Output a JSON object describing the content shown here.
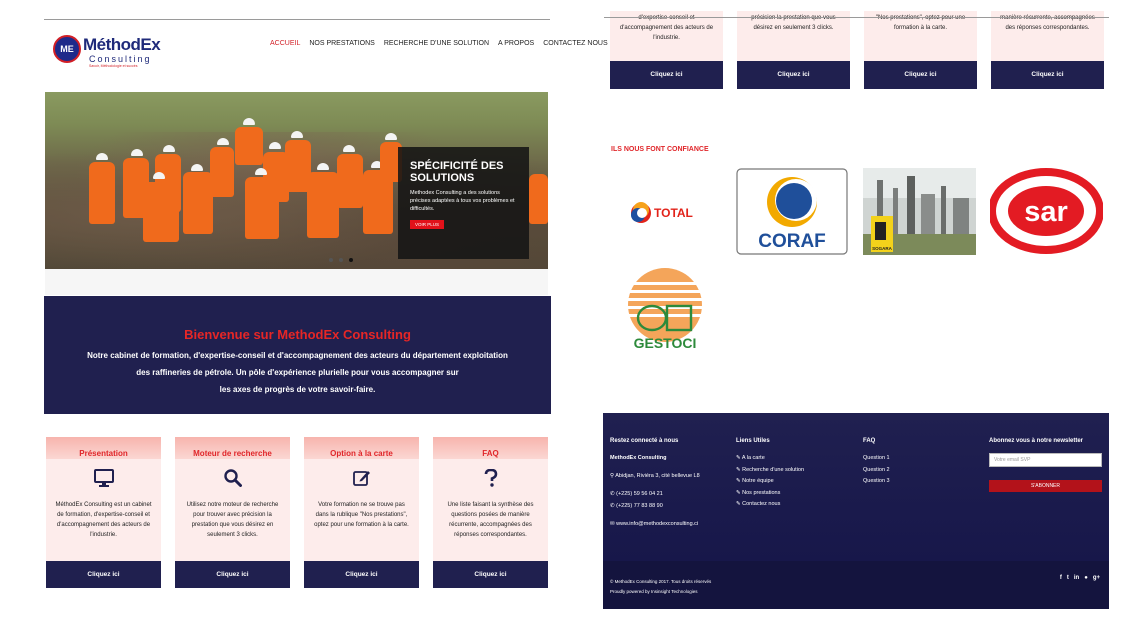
{
  "colors": {
    "brand_navy": "#20204f",
    "brand_red": "#e0262a",
    "card_bg": "#fdeceb"
  },
  "logo": {
    "monogram": "ME",
    "brand": "MéthodEx",
    "sub": "Consulting",
    "tagline": "Savoir, Méthodologie et succès"
  },
  "nav": {
    "items": [
      {
        "label": "ACCUEIL",
        "active": true
      },
      {
        "label": "NOS PRESTATIONS"
      },
      {
        "label": "RECHERCHE D'UNE SOLUTION"
      },
      {
        "label": "A PROPOS"
      },
      {
        "label": "CONTACTEZ NOUS"
      }
    ]
  },
  "hero": {
    "title": "SPÉCIFICITÉ DES SOLUTIONS",
    "text": "Methodex Consulting a des solutions précises adaptées à tous vos problèmes et difficultés.",
    "button": "VOIR PLUS"
  },
  "welcome": {
    "title": "Bienvenue sur MethodEx Consulting",
    "line1": "Notre cabinet de formation, d'expertise-conseil et d'accompagnement des acteurs du département exploitation",
    "line2": "des raffineries de pétrole. Un pôle d'expérience plurielle pour vous accompagner sur",
    "line3": "les axes de progrès de votre savoir-faire."
  },
  "cards": [
    {
      "title": "Présentation",
      "icon": "monitor-icon",
      "text": "MéthodEx Consulting est un cabinet de formation, d'expertise-conseil et d'accompagnement des acteurs de l'industrie.",
      "cta": "Cliquez ici"
    },
    {
      "title": "Moteur de recherche",
      "icon": "search-icon",
      "text": "Utilisez notre moteur de recherche pour trouver avec précision la prestation que vous désirez en seulement 3 clicks.",
      "cta": "Cliquez ici"
    },
    {
      "title": "Option à la carte",
      "icon": "edit-icon",
      "text": "Votre formation ne se trouve pas dans la rublique \"Nos prestations\", optez pour une formation à la carte.",
      "cta": "Cliquez ici"
    },
    {
      "title": "FAQ",
      "icon": "question-icon",
      "text": "Une liste faisant la synthèse des questions posées de manière récurrente, accompagnées des réponses correspondantes.",
      "cta": "Cliquez ici"
    }
  ],
  "right_cards": [
    {
      "text": "d'expertise-conseil et d'accompagnement des acteurs de l'industrie.",
      "cta": "Cliquez ici"
    },
    {
      "text": "précision la prestation que vous désirez en seulement 3 clicks.",
      "cta": "Cliquez ici"
    },
    {
      "text": "\"Nos prestations\", optez pour une formation à la carte.",
      "cta": "Cliquez ici"
    },
    {
      "text": "manière récurrente, accompagnées des réponses correspondantes.",
      "cta": "Cliquez ici"
    }
  ],
  "trust": {
    "title": "ILS NOUS FONT CONFIANCE",
    "logos": [
      {
        "name": "TOTAL"
      },
      {
        "name": "CORAF"
      },
      {
        "name": "SOGARA"
      },
      {
        "name": "sar"
      },
      {
        "name": "GESTOCI"
      }
    ]
  },
  "footer": {
    "col1": {
      "title": "Restez connecté à nous",
      "company": "MethodEx Consulting",
      "address": "Abidjan, Riviéra 3, cité bellevue L8",
      "phone1": "(+225) 59 56 04 21",
      "phone2": "(+225) 77 83 88 90",
      "website": "www.info@methodexconsulting.ci"
    },
    "col2": {
      "title": "Liens Utiles",
      "links": [
        "A la carte",
        "Recherche d'une solution",
        "Notre équipe",
        "Nos prestations",
        "Contactez nous"
      ]
    },
    "col3": {
      "title": "FAQ",
      "links": [
        "Question 1",
        "Question 2",
        "Question 3"
      ]
    },
    "col4": {
      "title": "Abonnez vous à notre newsletter",
      "placeholder": "Votre email SVP",
      "button": "S'ABONNER"
    },
    "copyright": "© MethodEx Consulting 2017. Tous droits réservés",
    "powered": "Proudly powered by Insinsight Technologies",
    "social": [
      "f",
      "t",
      "in",
      "●",
      "g+"
    ]
  }
}
